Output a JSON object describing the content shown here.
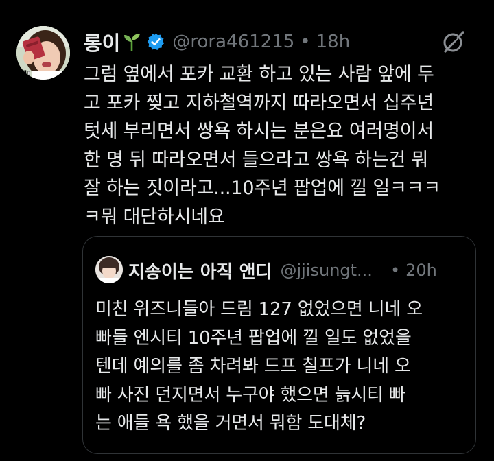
{
  "tweet": {
    "author": {
      "display_name": "롱이",
      "emoji_icon": "sprout-icon",
      "verified_icon": "verified-badge-icon",
      "handle": "@rora461215",
      "separator": "•",
      "time": "18h",
      "avatar_caption": "에!"
    },
    "header_icon": "grok-icon",
    "body_lines": [
      "그럼 옆에서 포카 교환 하고 있는 사람 앞에 두",
      "고 포카 찢고 지하철역까지 따라오면서 십주년",
      "텃세 부리면서 쌍욕 하시는 분은요 여러명이서",
      "한 명 뒤 따라오면서 들으라고 쌍욕 하는건 뭐",
      "잘 하는 짓이라고...10주년 팝업에 낄 일ㅋㅋㅋ",
      "ㅋ뭐 대단하시네요"
    ]
  },
  "quote": {
    "author": {
      "display_name": "지송이는 아직 앤디",
      "handle": "@jjisungt...",
      "separator": "•",
      "time": "20h"
    },
    "body_lines": [
      "미친 위즈니들아 드림 127 없었으면 니네 오",
      "빠들 엔시티 10주년 팝업에 낄 일도 없었을",
      "텐데 예의를 좀 차려봐 드프 칠프가 니네 오",
      "빠 사진 던지면서 누구야 했으면 늙시티 빠",
      "는 애들 욕 했을 거면서 뭐함 도대체?"
    ]
  },
  "colors": {
    "background": "#000000",
    "text_primary": "#e7e9ea",
    "text_secondary": "#71767b",
    "border": "#2f3336",
    "verified_blue": "#1d9bf0"
  }
}
